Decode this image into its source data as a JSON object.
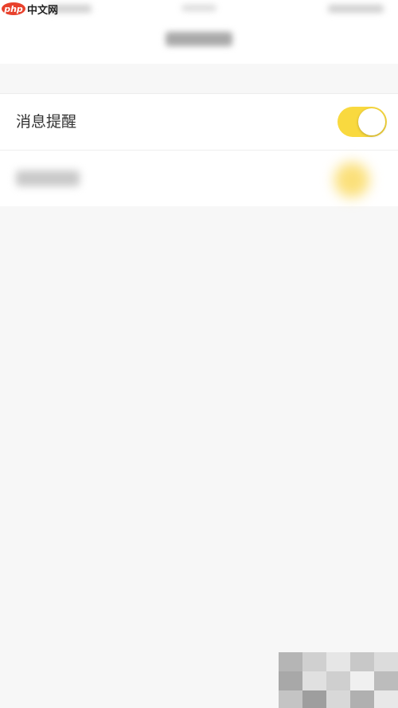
{
  "watermark": {
    "logo_text": "php",
    "site_text": "中文网"
  },
  "settings": {
    "items": [
      {
        "label": "消息提醒",
        "toggle_on": true
      },
      {
        "label": "",
        "toggle_on": true
      }
    ]
  },
  "colors": {
    "toggle_on": "#f9d93f",
    "background": "#f7f7f7",
    "row_background": "#ffffff",
    "label_text": "#333333"
  },
  "icons": {
    "watermark": "php-logo-icon"
  }
}
